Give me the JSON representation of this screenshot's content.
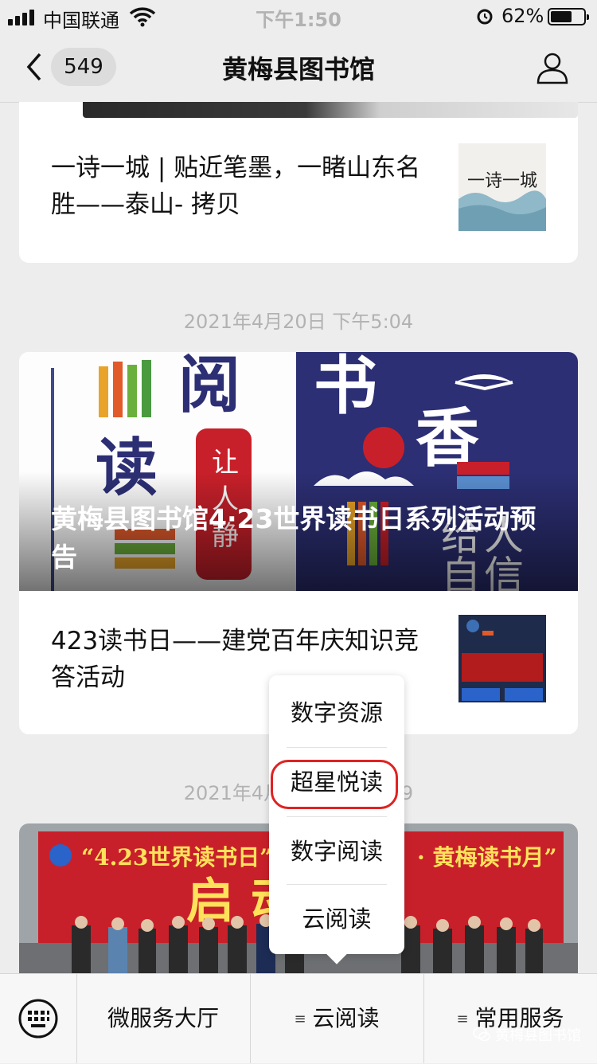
{
  "status_bar": {
    "carrier": "中国联通",
    "time": "下午1:50",
    "battery_percent": "62%",
    "battery_level": 0.62
  },
  "nav": {
    "back_count": "549",
    "title": "黄梅县图书馆"
  },
  "messages": {
    "item1_title": "一诗一城 | 贴近笔墨，一睹山东名胜——泰山- 拷贝",
    "item1_thumb_text": "一诗一城",
    "time1": "2021年4月20日 下午5:04",
    "banner_title": "黄梅县图书馆4·23世界读书日系列活动预告",
    "banner_chars": [
      "阅",
      "读",
      "让",
      "人",
      "静",
      "书",
      "香",
      "给",
      "人",
      "自",
      "信"
    ],
    "item2_title": "423读书日——建党百年庆知识竞答活动",
    "time2": "2021年4月20日 下午5:29",
    "banner2_text_left": "“4.23世界读书日”",
    "banner2_text_right": "· 黄梅读书月”",
    "banner2_big": "启 动"
  },
  "popup_menu": {
    "items": [
      "数字资源",
      "超星悦读",
      "数字阅读",
      "云阅读"
    ],
    "highlighted": "超星悦读"
  },
  "bottom_menu": {
    "items": [
      "微服务大厅",
      "云阅读",
      "常用服务"
    ]
  },
  "watermark": "黄梅县图书馆",
  "colors": {
    "highlight": "#e02222",
    "banner_blue": "#2c2f74",
    "banner_red": "#c8202a"
  }
}
